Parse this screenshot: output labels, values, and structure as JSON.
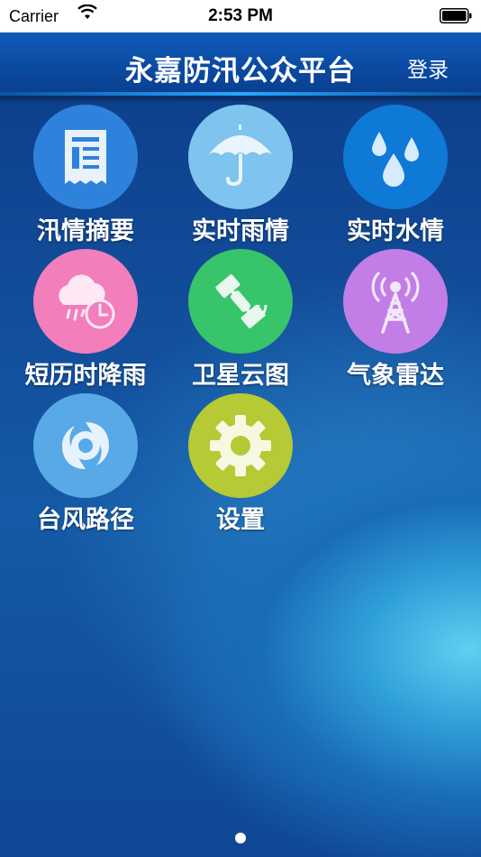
{
  "status_bar": {
    "carrier": "Carrier",
    "time": "2:53 PM"
  },
  "header": {
    "title": "永嘉防汛公众平台",
    "login": "登录"
  },
  "menu": [
    {
      "label": "汛情摘要",
      "icon": "document-icon",
      "color": "#2e82dc"
    },
    {
      "label": "实时雨情",
      "icon": "umbrella-icon",
      "color": "#7ec4ef"
    },
    {
      "label": "实时水情",
      "icon": "water-drops-icon",
      "color": "#0f79d6"
    },
    {
      "label": "短历时降雨",
      "icon": "cloud-rain-clock-icon",
      "color": "#f27ebc"
    },
    {
      "label": "卫星云图",
      "icon": "satellite-icon",
      "color": "#37c46a"
    },
    {
      "label": "气象雷达",
      "icon": "radar-tower-icon",
      "color": "#c27ee6"
    },
    {
      "label": "台风路径",
      "icon": "typhoon-icon",
      "color": "#58a9e6"
    },
    {
      "label": "设置",
      "icon": "gear-icon",
      "color": "#b7c934"
    }
  ],
  "pager": {
    "pages": 1,
    "current": 1
  }
}
